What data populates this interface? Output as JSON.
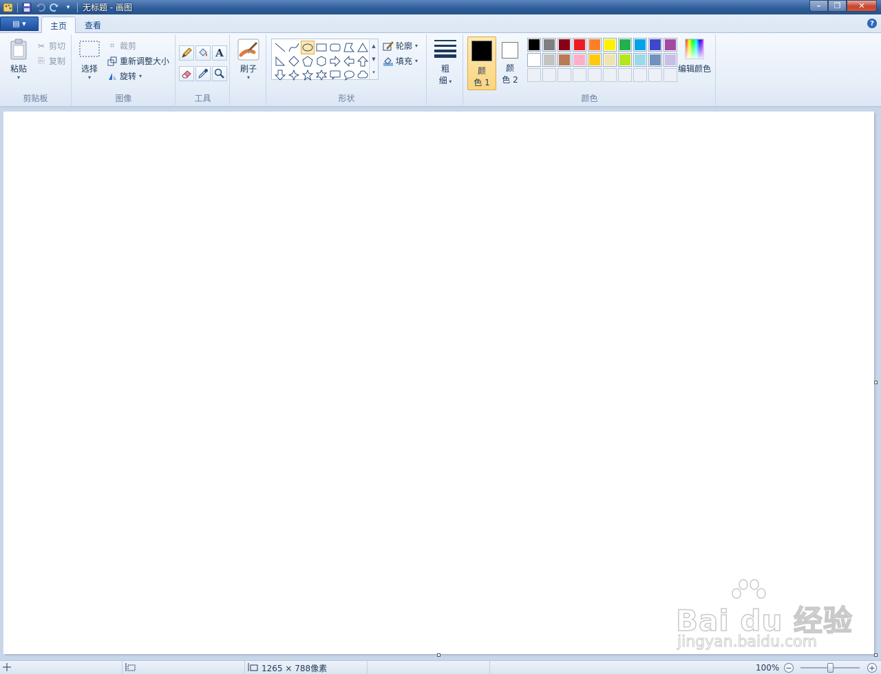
{
  "window": {
    "title": "无标题 - 画图",
    "qat_icons": [
      "paint-app-icon",
      "save-icon",
      "undo-icon",
      "redo-icon",
      "customize-qat-icon"
    ],
    "min_glyph": "–",
    "max_glyph": "❐",
    "close_glyph": "✕"
  },
  "tabs": {
    "menu_glyph": "▤ ▾",
    "home": "主页",
    "view": "查看",
    "help_glyph": "?"
  },
  "clipboard": {
    "paste": "粘贴",
    "cut": "剪切",
    "copy": "复制",
    "group_label": "剪贴板"
  },
  "image": {
    "select": "选择",
    "crop": "裁剪",
    "resize": "重新调整大小",
    "rotate": "旋转",
    "group_label": "图像"
  },
  "tools": {
    "group_label": "工具",
    "items": [
      "pencil-icon",
      "fill-icon",
      "text-icon",
      "eraser-icon",
      "color-picker-icon",
      "magnifier-icon"
    ]
  },
  "brushes": {
    "label": "刷子"
  },
  "shapes": {
    "group_label": "形状",
    "outline": "轮廓",
    "fill": "填充",
    "selected": "oval"
  },
  "size": {
    "label_line1": "粗",
    "label_line2": "细"
  },
  "colors": {
    "group_label": "颜色",
    "color1_line1": "颜",
    "color1_line2": "色 1",
    "color2_line1": "颜",
    "color2_line2": "色 2",
    "color1_value": "#000000",
    "color2_value": "#ffffff",
    "edit_colors": "编辑颜色",
    "palette_row1": [
      "#000000",
      "#7f7f7f",
      "#880015",
      "#ed1c24",
      "#ff7f27",
      "#fff200",
      "#22b14c",
      "#00a2e8",
      "#3f48cc",
      "#a349a4"
    ],
    "palette_row2": [
      "#ffffff",
      "#c3c3c3",
      "#b97a57",
      "#ffaec9",
      "#ffc90e",
      "#efe4b0",
      "#b5e61d",
      "#99d9ea",
      "#7092be",
      "#c8bfe7"
    ]
  },
  "canvas": {
    "background": "#ffffff"
  },
  "watermark": {
    "main": "Bai du 经验",
    "sub": "jingyan.baidu.com"
  },
  "statusbar": {
    "canvas_size": "1265 × 788像素",
    "zoom": "100%",
    "zoom_out_glyph": "−",
    "zoom_in_glyph": "+"
  }
}
